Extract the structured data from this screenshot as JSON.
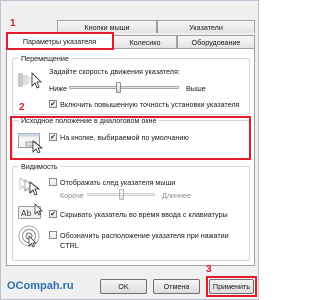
{
  "tabs": {
    "row1": [
      "Кнопки мыши",
      "Указатели"
    ],
    "row2": [
      "Параметры указателя",
      "Колесико",
      "Оборудование"
    ]
  },
  "motion": {
    "title": "Перемещение",
    "speed_label": "Задайте скорость движения указателя:",
    "slow": "Ниже",
    "fast": "Выше",
    "precision_label": "Включить повышенную точность установки указателя",
    "precision_checked": "✔"
  },
  "snap": {
    "title": "Исходное положение в диалоговом окне",
    "label": "На кнопке, выбираемой по умолчанию",
    "checked": "✔"
  },
  "visibility": {
    "title": "Видимость",
    "trails_label": "Отображать след указателя мыши",
    "short": "Короче",
    "long": "Длиннее",
    "hide_label": "Скрывать указатель во время ввода с клавиатуры",
    "hide_checked": "✔",
    "ctrl_label_line1": "Обозначить расположение указателя при нажатии",
    "ctrl_label_line2": "CTRL"
  },
  "buttons": {
    "ok": "OK",
    "cancel": "Отмена",
    "apply": "Применить"
  },
  "annotations": {
    "badge1": "1",
    "badge2": "2",
    "badge3": "3",
    "color": "#e31b2b"
  },
  "watermark": "OCompah.ru"
}
